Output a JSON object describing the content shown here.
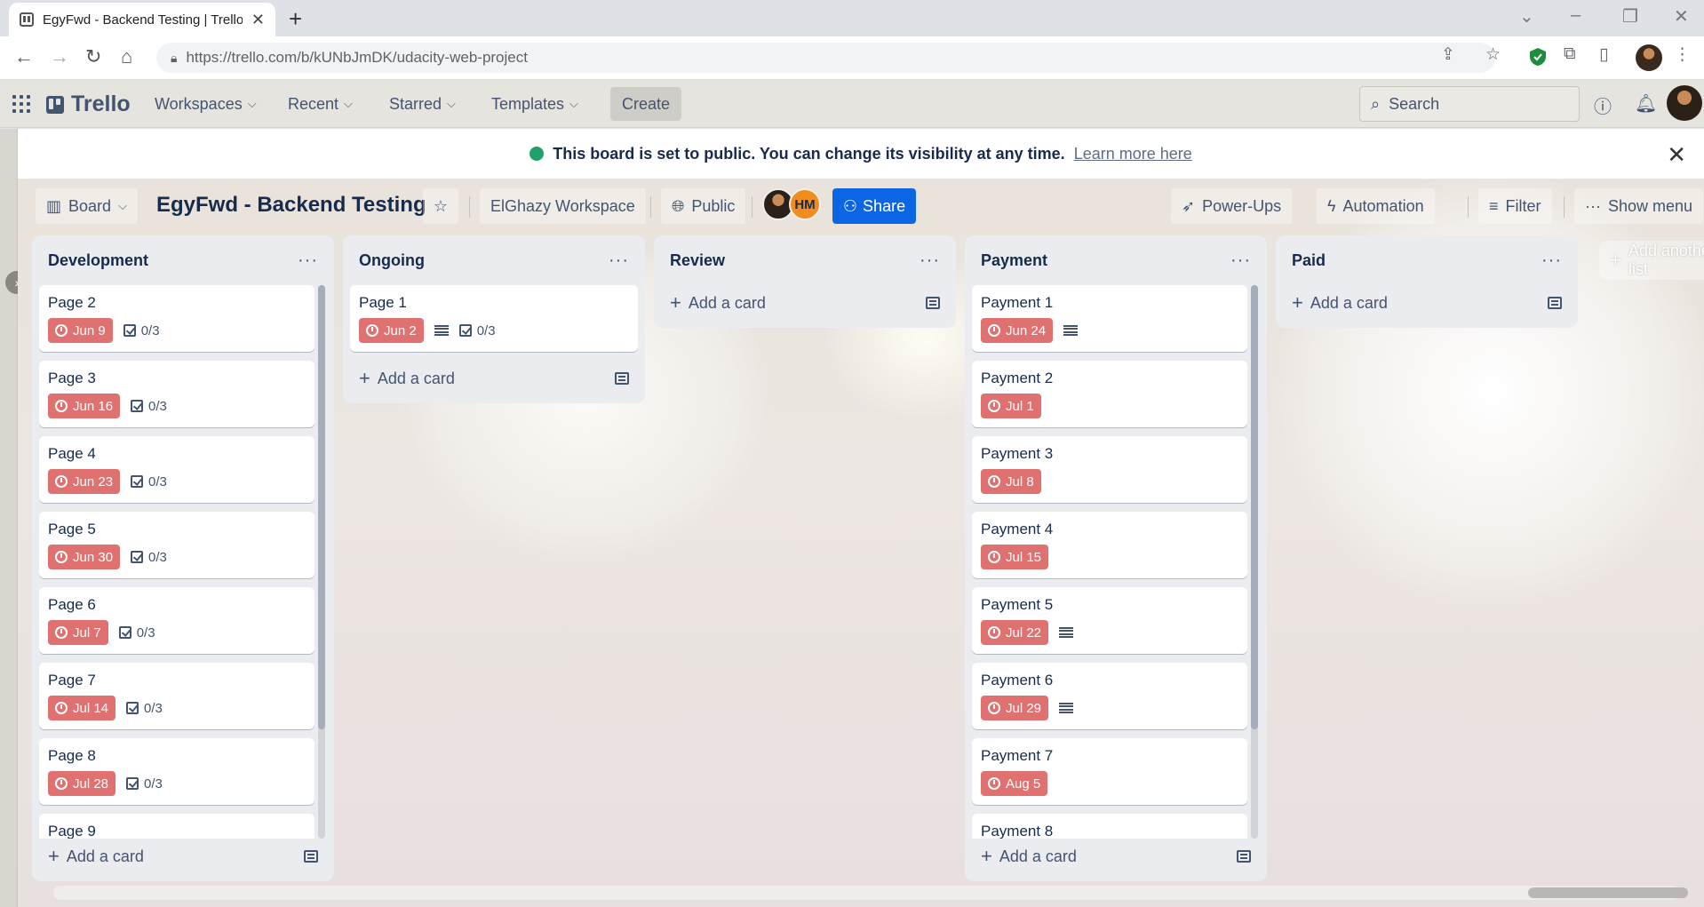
{
  "browser": {
    "tab_title": "EgyFwd - Backend Testing | Trello",
    "tab_close": "✕",
    "new_tab": "+",
    "url": "https://trello.com/b/kUNbJmDK/udacity-web-project"
  },
  "header": {
    "logo": "Trello",
    "menus": [
      "Workspaces",
      "Recent",
      "Starred",
      "Templates"
    ],
    "create": "Create",
    "search_placeholder": "Search"
  },
  "banner": {
    "text": "This board is set to public. You can change its visibility at any time.",
    "link": "Learn more here"
  },
  "boardbar": {
    "view": "Board",
    "title": "EgyFwd - Backend Testing",
    "workspace": "ElGhazy Workspace",
    "visibility": "Public",
    "member_initials": "HM",
    "share": "Share",
    "powerups": "Power-Ups",
    "automation": "Automation",
    "filter": "Filter",
    "show_menu": "Show menu"
  },
  "lists": [
    {
      "title": "Development",
      "cards": [
        {
          "title": "Page 2",
          "due": "Jun 9",
          "desc": false,
          "checklist": "0/3"
        },
        {
          "title": "Page 3",
          "due": "Jun 16",
          "desc": false,
          "checklist": "0/3"
        },
        {
          "title": "Page 4",
          "due": "Jun 23",
          "desc": false,
          "checklist": "0/3"
        },
        {
          "title": "Page 5",
          "due": "Jun 30",
          "desc": false,
          "checklist": "0/3"
        },
        {
          "title": "Page 6",
          "due": "Jul 7",
          "desc": false,
          "checklist": "0/3"
        },
        {
          "title": "Page 7",
          "due": "Jul 14",
          "desc": false,
          "checklist": "0/3"
        },
        {
          "title": "Page 8",
          "due": "Jul 28",
          "desc": false,
          "checklist": "0/3"
        },
        {
          "title": "Page 9",
          "due": "",
          "desc": false,
          "checklist": ""
        }
      ],
      "add_card": "Add a card"
    },
    {
      "title": "Ongoing",
      "cards": [
        {
          "title": "Page 1",
          "due": "Jun 2",
          "desc": true,
          "checklist": "0/3"
        }
      ],
      "add_card": "Add a card"
    },
    {
      "title": "Review",
      "cards": [],
      "add_card": "Add a card"
    },
    {
      "title": "Payment",
      "cards": [
        {
          "title": "Payment 1",
          "due": "Jun 24",
          "desc": true,
          "checklist": ""
        },
        {
          "title": "Payment 2",
          "due": "Jul 1",
          "desc": false,
          "checklist": ""
        },
        {
          "title": "Payment 3",
          "due": "Jul 8",
          "desc": false,
          "checklist": ""
        },
        {
          "title": "Payment 4",
          "due": "Jul 15",
          "desc": false,
          "checklist": ""
        },
        {
          "title": "Payment 5",
          "due": "Jul 22",
          "desc": true,
          "checklist": ""
        },
        {
          "title": "Payment 6",
          "due": "Jul 29",
          "desc": true,
          "checklist": ""
        },
        {
          "title": "Payment 7",
          "due": "Aug 5",
          "desc": false,
          "checklist": ""
        },
        {
          "title": "Payment 8",
          "due": "",
          "desc": false,
          "checklist": ""
        }
      ],
      "add_card": "Add a card"
    },
    {
      "title": "Paid",
      "cards": [],
      "add_card": "Add a card"
    }
  ],
  "add_list": "Add another list",
  "colors": {
    "due_badge": "#e07171",
    "share_button": "#0c66e4",
    "list_bg": "#ebecf0",
    "public_icon": "#22a06b"
  }
}
